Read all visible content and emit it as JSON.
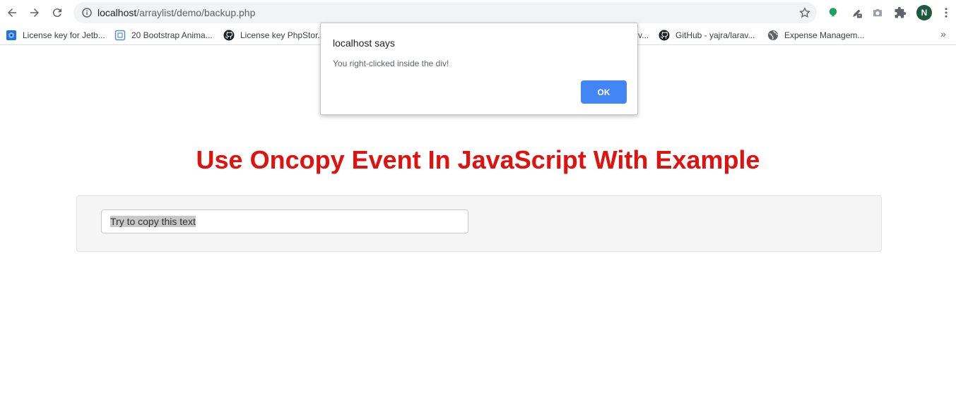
{
  "browser": {
    "url_host": "localhost",
    "url_path": "/arraylist/demo/backup.php",
    "profile_initial": "N",
    "icons": {
      "back": "back-arrow-icon",
      "forward": "forward-arrow-icon",
      "reload": "reload-icon",
      "info": "info-icon",
      "star": "star-icon",
      "extension_green": "green-extension-icon",
      "eyedropper": "eyedropper-icon",
      "camera": "camera-icon",
      "puzzle": "puzzle-icon",
      "menu": "kebab-menu-icon"
    }
  },
  "bookmarks": [
    {
      "label": "License key for Jetb...",
      "icon": "blue-circle-icon"
    },
    {
      "label": "20 Bootstrap Anima...",
      "icon": "bootstrap-icon"
    },
    {
      "label": "License key PhpStor...",
      "icon": "github-icon"
    },
    {
      "label": "v...",
      "icon": ""
    },
    {
      "label": "GitHub - yajra/larav...",
      "icon": "github-icon"
    },
    {
      "label": "Expense Managem...",
      "icon": "globe-icon"
    }
  ],
  "bookmarks_overflow": "»",
  "dialog": {
    "title": "localhost says",
    "message": "You right-clicked inside the div!",
    "ok_label": "OK"
  },
  "page": {
    "title": "Use Oncopy Event In JavaScript With Example",
    "input_value": "Try to copy this text"
  },
  "colors": {
    "title_red": "#e0120f",
    "ok_blue": "#4285f4",
    "well_bg": "#f5f5f5"
  }
}
